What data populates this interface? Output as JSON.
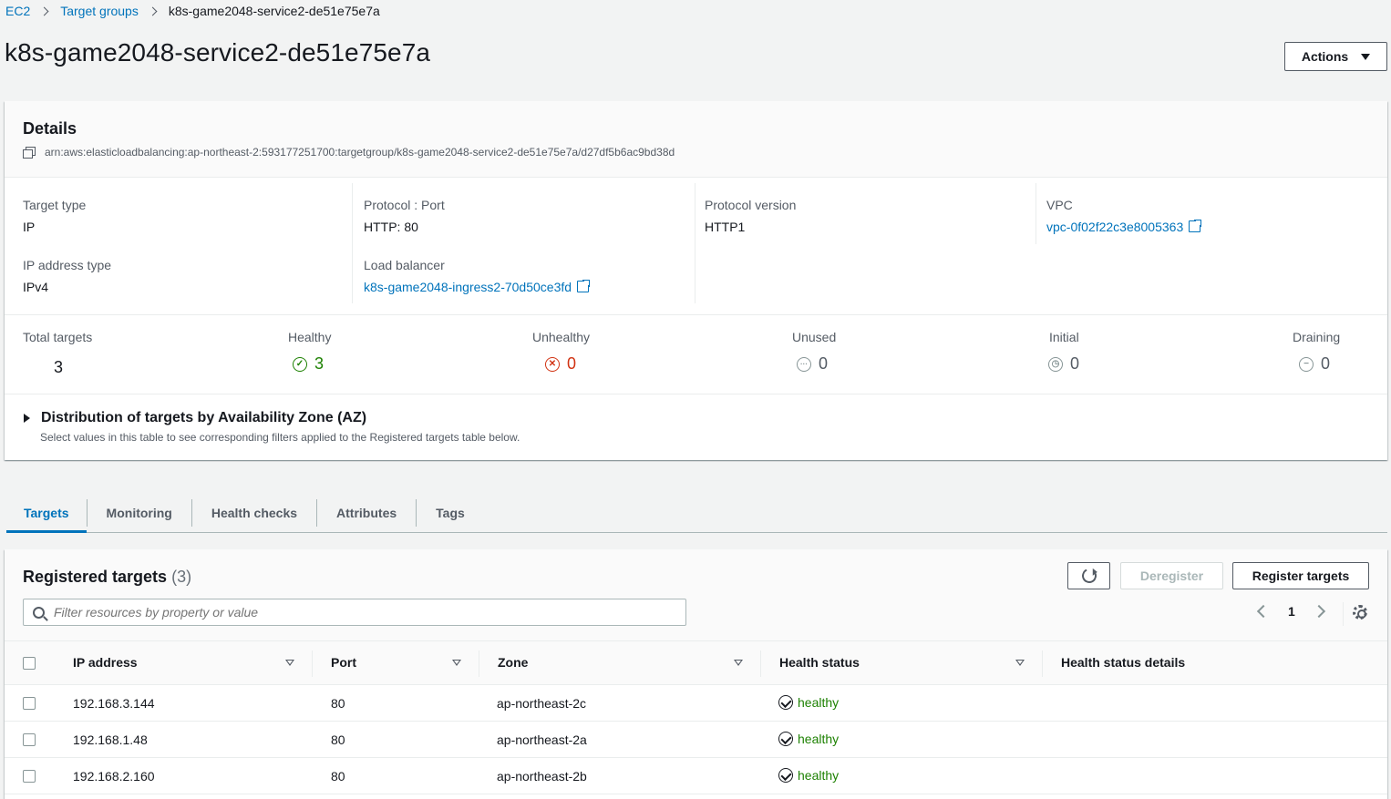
{
  "breadcrumb": {
    "items": [
      "EC2",
      "Target groups"
    ],
    "current": "k8s-game2048-service2-de51e75e7a"
  },
  "page": {
    "title": "k8s-game2048-service2-de51e75e7a",
    "actions_label": "Actions"
  },
  "details": {
    "heading": "Details",
    "arn": "arn:aws:elasticloadbalancing:ap-northeast-2:593177251700:targetgroup/k8s-game2048-service2-de51e75e7a/d27df5b6ac9bd38d",
    "target_type_label": "Target type",
    "target_type": "IP",
    "ip_address_type_label": "IP address type",
    "ip_address_type": "IPv4",
    "protocol_port_label": "Protocol : Port",
    "protocol_port": "HTTP: 80",
    "load_balancer_label": "Load balancer",
    "load_balancer": "k8s-game2048-ingress2-70d50ce3fd",
    "protocol_version_label": "Protocol version",
    "protocol_version": "HTTP1",
    "vpc_label": "VPC",
    "vpc": "vpc-0f02f22c3e8005363"
  },
  "counts": {
    "total_label": "Total targets",
    "total": "3",
    "healthy_label": "Healthy",
    "healthy": "3",
    "unhealthy_label": "Unhealthy",
    "unhealthy": "0",
    "unused_label": "Unused",
    "unused": "0",
    "initial_label": "Initial",
    "initial": "0",
    "draining_label": "Draining",
    "draining": "0"
  },
  "distribution": {
    "title": "Distribution of targets by Availability Zone (AZ)",
    "subtitle": "Select values in this table to see corresponding filters applied to the Registered targets table below."
  },
  "tabs": [
    "Targets",
    "Monitoring",
    "Health checks",
    "Attributes",
    "Tags"
  ],
  "registered": {
    "title": "Registered targets",
    "count": "(3)",
    "deregister_label": "Deregister",
    "register_label": "Register targets",
    "filter_placeholder": "Filter resources by property or value",
    "page": "1",
    "columns": [
      "IP address",
      "Port",
      "Zone",
      "Health status",
      "Health status details"
    ],
    "rows": [
      {
        "ip": "192.168.3.144",
        "port": "80",
        "zone": "ap-northeast-2c",
        "health": "healthy",
        "details": ""
      },
      {
        "ip": "192.168.1.48",
        "port": "80",
        "zone": "ap-northeast-2a",
        "health": "healthy",
        "details": ""
      },
      {
        "ip": "192.168.2.160",
        "port": "80",
        "zone": "ap-northeast-2b",
        "health": "healthy",
        "details": ""
      }
    ]
  },
  "colors": {
    "link": "#0073bb",
    "healthy": "#1d8102",
    "unhealthy": "#d13212",
    "neutral": "#879596"
  }
}
